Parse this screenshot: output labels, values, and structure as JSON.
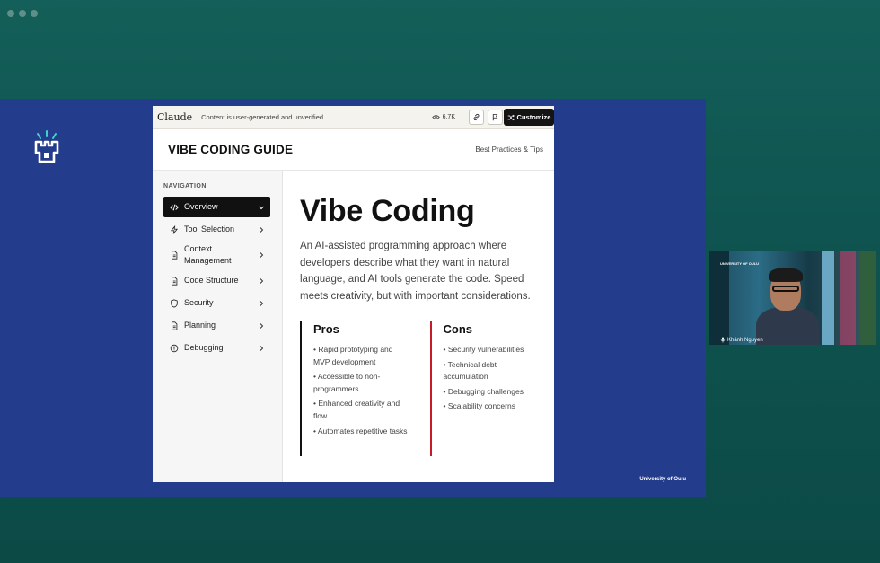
{
  "claude_bar": {
    "brand": "Claude",
    "notice": "Content is user-generated and unverified.",
    "views": "6.7K",
    "customize_label": "Customize"
  },
  "guide": {
    "title": "VIBE CODING GUIDE",
    "subtitle": "Best Practices & Tips"
  },
  "navigation": {
    "heading": "NAVIGATION",
    "items": [
      {
        "label": "Overview",
        "icon": "code-icon",
        "active": true
      },
      {
        "label": "Tool Selection",
        "icon": "lightning-icon"
      },
      {
        "label": "Context Management",
        "icon": "document-icon"
      },
      {
        "label": "Code Structure",
        "icon": "document-icon"
      },
      {
        "label": "Security",
        "icon": "shield-icon"
      },
      {
        "label": "Planning",
        "icon": "document-icon"
      },
      {
        "label": "Debugging",
        "icon": "alert-circle-icon"
      }
    ]
  },
  "content": {
    "heading": "Vibe Coding",
    "intro": "An AI-assisted programming approach where developers describe what they want in natural language, and AI tools generate the code. Speed meets creativity, but with important considerations.",
    "pros": {
      "title": "Pros",
      "items": [
        "• Rapid prototyping and MVP development",
        "• Accessible to non-programmers",
        "• Enhanced creativity and flow",
        "• Automates repetitive tasks"
      ]
    },
    "cons": {
      "title": "Cons",
      "items": [
        "• Security vulnerabilities",
        "• Technical debt accumulation",
        "• Debugging challenges",
        "• Scalability concerns"
      ]
    }
  },
  "presentation": {
    "footer": "University of Oulu"
  },
  "participant": {
    "name": "Khánh Nguyen",
    "badge": "UNIVERSITY OF OULU"
  },
  "colors": {
    "stage_blue": "#233c8c",
    "window_teal": "#0f5450",
    "cons_accent": "#c61c2a"
  }
}
